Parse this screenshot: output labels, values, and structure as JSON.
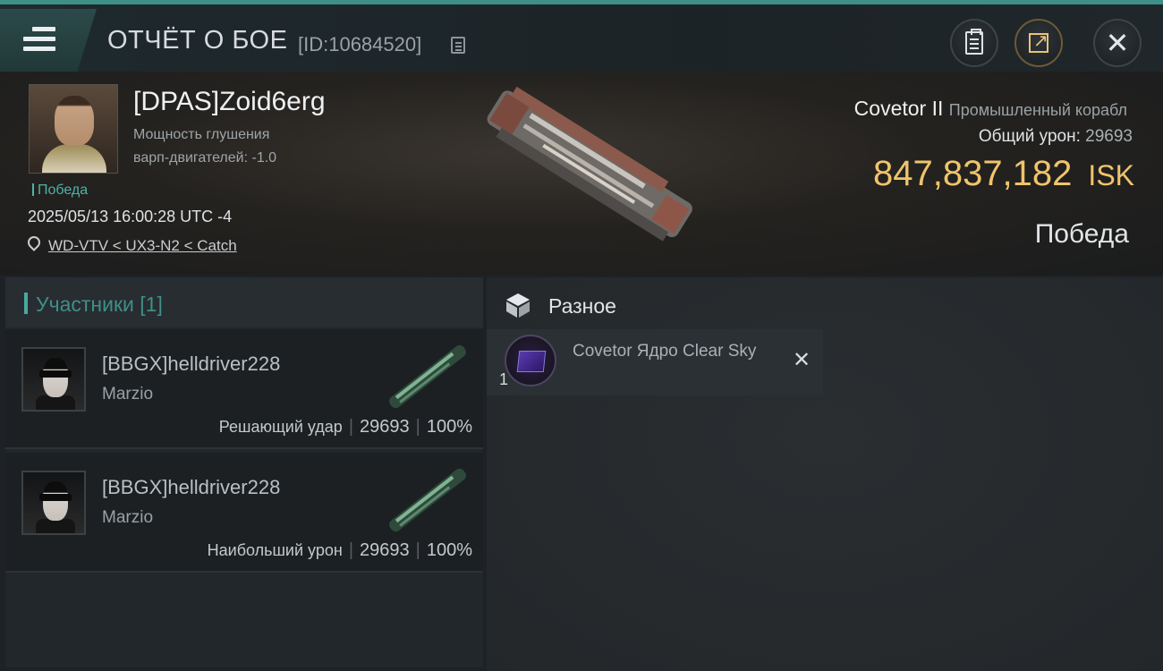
{
  "header": {
    "title": "ОТЧЁТ О БОЕ",
    "report_id": "[ID:10684520]"
  },
  "victim": {
    "name": "[DPAS]Zoid6erg",
    "stat_line1": "Мощность глушения",
    "stat_line2": "варп-двигателей: -1.0",
    "result_tag": "Победа",
    "timestamp": "2025/05/13 16:00:28 UTC -4",
    "location": "WD-VTV < UX3-N2 < Catch",
    "ship_name": "Covetor II",
    "ship_class": "Промышленный корабл",
    "total_damage_label": "Общий урон:",
    "total_damage_value": "29693",
    "isk_value": "847,837,182",
    "isk_unit": "ISK",
    "outcome": "Победа"
  },
  "participants": {
    "header": "Участники [1]",
    "rows": [
      {
        "name": "[BBGX]helldriver228",
        "ship": "Marzio",
        "role": "Решающий удар",
        "damage": "29693",
        "percent": "100%"
      },
      {
        "name": "[BBGX]helldriver228",
        "ship": "Marzio",
        "role": "Наибольший урон",
        "damage": "29693",
        "percent": "100%"
      }
    ]
  },
  "items": {
    "section_label": "Разное",
    "list": [
      {
        "name": "Covetor Ядро Clear Sky",
        "qty": "1"
      }
    ]
  },
  "colors": {
    "accent": "#3e8f86",
    "isk": "#f0c46c",
    "tag": "#4db3a6"
  },
  "icons": [
    "hamburger-menu-icon",
    "copy-icon",
    "clipboard-icon",
    "share-icon",
    "close-icon",
    "location-pin-icon",
    "cube-icon",
    "remove-icon"
  ]
}
